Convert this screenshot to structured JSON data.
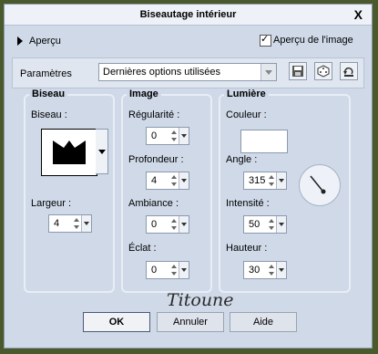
{
  "dialog": {
    "title": "Biseautage intérieur",
    "close_label": "X",
    "preview_label": "Aperçu",
    "preview_checkbox_label": "Aperçu de l'image",
    "preview_checked": true
  },
  "params": {
    "label": "Paramètres",
    "preset": "Dernières options utilisées",
    "icons": [
      "save-icon",
      "dice-icon",
      "reset-icon"
    ]
  },
  "bevel_group": {
    "title": "Biseau",
    "shape_label": "Biseau :",
    "width_label": "Largeur :",
    "width_value": "4"
  },
  "image_group": {
    "title": "Image",
    "smoothness_label": "Régularité :",
    "smoothness_value": "0",
    "depth_label": "Profondeur :",
    "depth_value": "4",
    "ambience_label": "Ambiance :",
    "ambience_value": "0",
    "shine_label": "Éclat :",
    "shine_value": "0"
  },
  "light_group": {
    "title": "Lumière",
    "color_label": "Couleur :",
    "color_value": "#ffffff",
    "angle_label": "Angle :",
    "angle_value": "315",
    "intensity_label": "Intensité :",
    "intensity_value": "50",
    "elevation_label": "Hauteur :",
    "elevation_value": "30"
  },
  "signature": "Titoune",
  "buttons": {
    "ok": "OK",
    "cancel": "Annuler",
    "help": "Aide"
  }
}
